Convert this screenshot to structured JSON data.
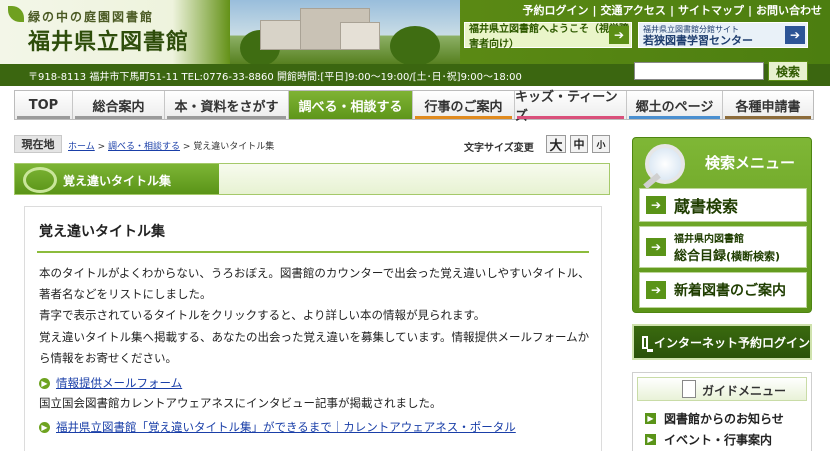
{
  "header": {
    "logo_subtitle": "緑の中の庭園図書館",
    "logo_title": "福井県立図書館",
    "top_links": [
      "予約ログイン",
      "交通アクセス",
      "サイトマップ",
      "お問い合わせ"
    ],
    "banner_left": "福井県立図書館へようこそ（視覚障害者向け）",
    "banner_right_line1": "福井県立図書館分館サイト",
    "banner_right_line2": "若狭図書学習センター",
    "info_text": "〒918-8113 福井市下馬町51-11 TEL:0776-33-8860 開館時間:[平日]9:00～19:00/[土･日･祝]9:00～18:00",
    "search_button": "検索",
    "search_value": ""
  },
  "nav": [
    {
      "label": "TOP",
      "color": "#7a7a7a"
    },
    {
      "label": "総合案内",
      "color": "#7a7a7a"
    },
    {
      "label": "本・資料をさがす",
      "color": "#7a7a7a"
    },
    {
      "label": "調べる・相談する",
      "color": "#5e961a"
    },
    {
      "label": "行事のご案内",
      "color": "#e08a1e"
    },
    {
      "label": "キッズ・ティーンズ",
      "color": "#d94f7a"
    },
    {
      "label": "郷土のページ",
      "color": "#4a8fd0"
    },
    {
      "label": "各種申請書",
      "color": "#8c6b3a"
    }
  ],
  "breadcrumb": {
    "label": "現在地",
    "home": "ホーム",
    "sep": " > ",
    "section": "調べる・相談する",
    "current": "覚え違いタイトル集"
  },
  "font_size": {
    "label": "文字サイズ変更",
    "large": "大",
    "medium": "中",
    "small": "小"
  },
  "main": {
    "heading": "覚え違いタイトル集",
    "title": "覚え違いタイトル集",
    "para1": "本のタイトルがよくわからない、うろおぼえ。図書館のカウンターで出会った覚え違いしやすいタイトル、著者名などをリストにしました。",
    "para2": "青字で表示されているタイトルをクリックすると、より詳しい本の情報が見られます。",
    "para3": "覚え違いタイトル集へ掲載する、あなたの出会った覚え違いを募集しています。情報提供メールフォームから情報をお寄せください。",
    "link1": "情報提供メールフォーム",
    "para4": "国立国会図書館カレントアウェアネスにインタビュー記事が掲載されました。",
    "link2": "福井県立図書館「覚え違いタイトル集」ができるまで｜カレントアウェアネス・ポータル"
  },
  "side": {
    "search_menu_title": "検索メニュー",
    "item1": "蔵書検索",
    "item2_line1": "福井県内図書館",
    "item2_line2": "総合目録",
    "item2_suffix": "(横断検索)",
    "item3": "新着図書のご案内",
    "login_button": "インターネット予約ログイン",
    "guide_title": "ガイドメニュー",
    "guide_items": [
      "図書館からのお知らせ",
      "イベント・行事案内"
    ]
  }
}
